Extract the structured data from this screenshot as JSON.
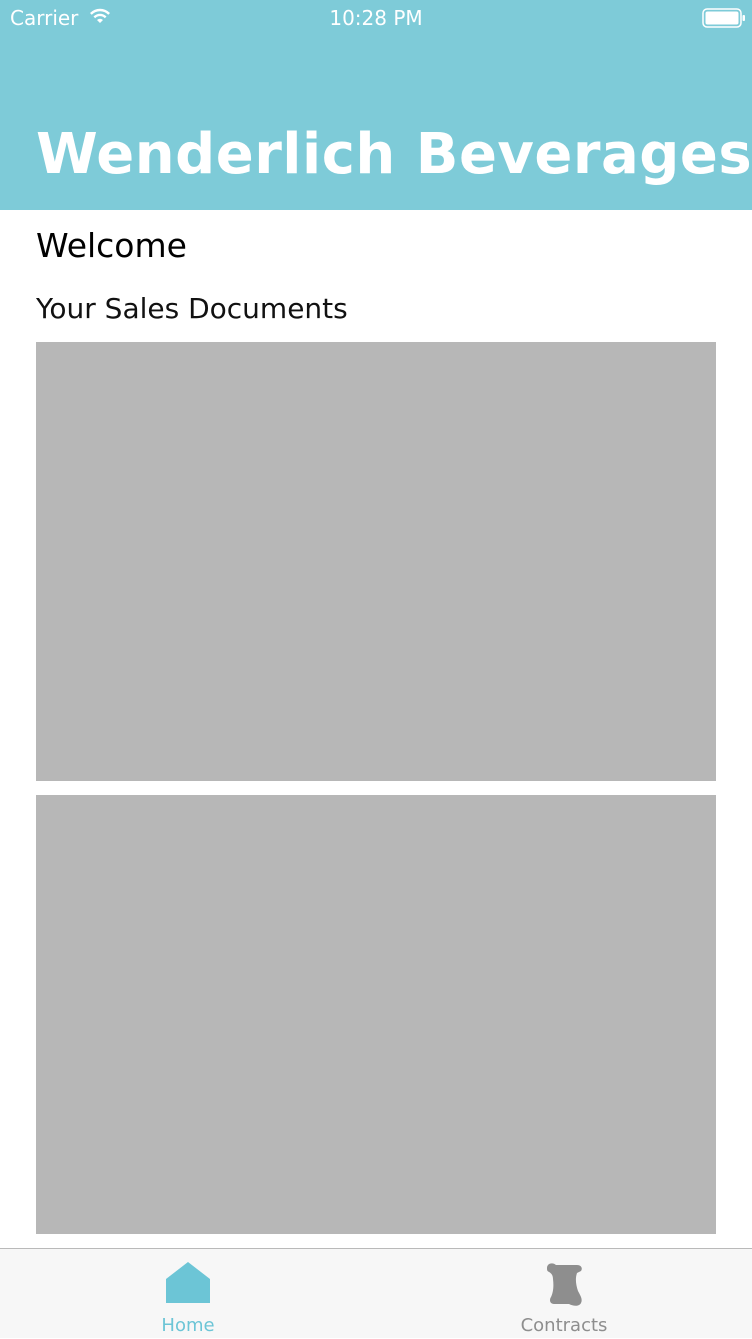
{
  "status_bar": {
    "carrier": "Carrier",
    "time": "10:28 PM",
    "wifi_icon": "wifi-icon",
    "battery_icon": "battery-icon"
  },
  "header": {
    "title": "Wenderlich Beverages",
    "background_color": "#7ecbd8"
  },
  "main": {
    "welcome": "Welcome",
    "documents_heading": "Your Sales Documents",
    "document_placeholder_color": "#b7b7b7"
  },
  "tab_bar": {
    "tabs": [
      {
        "label": "Home",
        "icon": "home-icon",
        "selected": true,
        "color": "#6cc5d6"
      },
      {
        "label": "Contracts",
        "icon": "scroll-icon",
        "selected": false,
        "color": "#8e8e8e"
      }
    ]
  }
}
